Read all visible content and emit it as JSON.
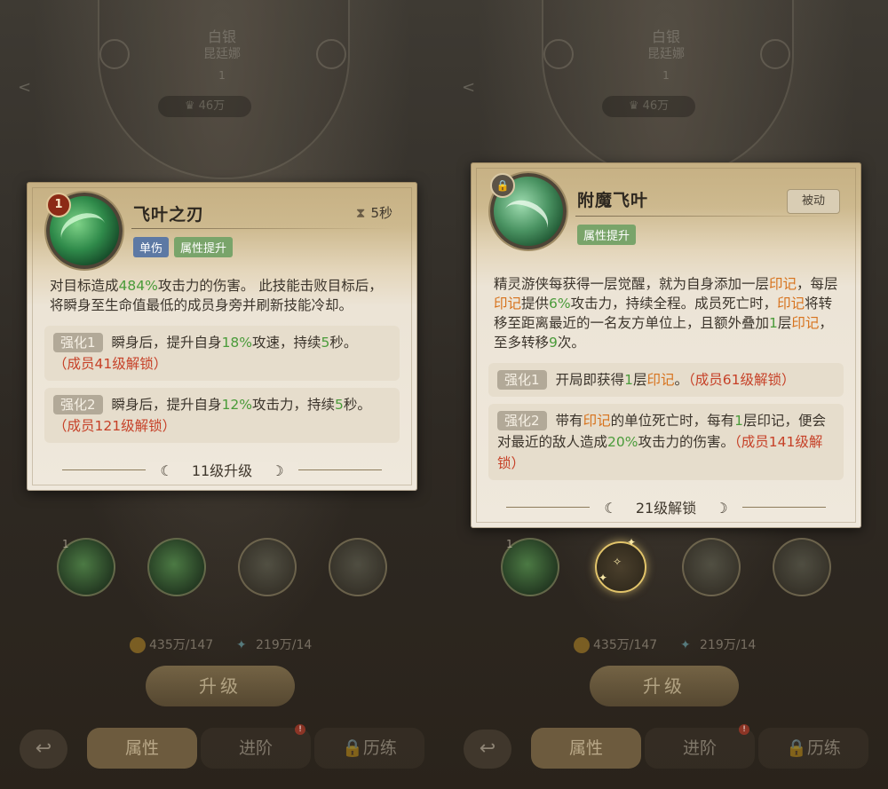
{
  "left": {
    "bg": {
      "title_line1": "白银",
      "title_line2": "昆廷娜",
      "title_line3": "1",
      "power": "46万"
    },
    "card": {
      "badge": "1",
      "name": "飞叶之刃",
      "cooldown": "5秒",
      "tags": [
        "单伤",
        "属性提升"
      ],
      "desc": {
        "p1": "对目标造成",
        "v1": "484%",
        "p2": "攻击力的伤害。 此技能击败目标后，将瞬身至生命值最低的成员身旁并刷新技能冷却。"
      },
      "enh1": {
        "label": "强化1",
        "p1": "瞬身后，提升自身",
        "v1": "18%",
        "p2": "攻速，持续",
        "v2": "5",
        "p3": "秒。",
        "lock": "（成员41级解锁）"
      },
      "enh2": {
        "label": "强化2",
        "p1": "瞬身后，提升自身",
        "v1": "12%",
        "p2": "攻击力，持续",
        "v2": "5",
        "p3": "秒。",
        "lock": "（成员121级解锁）"
      },
      "footer": "11级升级"
    },
    "slots": [
      "1",
      "",
      "",
      ""
    ],
    "cost": {
      "gold": "435万/147",
      "gem": "219万/14"
    },
    "upgrade": "升级",
    "tabs": [
      "属性",
      "进阶",
      "历练"
    ]
  },
  "right": {
    "bg": {
      "title_line1": "白银",
      "title_line2": "昆廷娜",
      "title_line3": "1",
      "power": "46万"
    },
    "card": {
      "name": "附魔飞叶",
      "passive": "被动",
      "tags": [
        "属性提升"
      ],
      "desc": {
        "p1": "精灵游侠每获得一层觉醒，就为自身添加一层",
        "k1": "印记",
        "p2": "，每层",
        "k2": "印记",
        "p3": "提供",
        "v1": "6%",
        "p4": "攻击力，持续全程。成员死亡时，",
        "k3": "印记",
        "p5": "将转移至距离最近的一名友方单位上，且额外叠加",
        "v2": "1",
        "p6": "层",
        "k4": "印记",
        "p7": "，至多转移",
        "v3": "9",
        "p8": "次。"
      },
      "enh1": {
        "label": "强化1",
        "p1": "开局即获得",
        "v1": "1",
        "p2": "层",
        "k1": "印记",
        "p3": "。",
        "lock": "（成员61级解锁）"
      },
      "enh2": {
        "label": "强化2",
        "p1": "带有",
        "k1": "印记",
        "p2": "的单位死亡时，每有",
        "v1": "1",
        "p3": "层印记，便会对最近的敌人造成",
        "v2": "20%",
        "p4": "攻击力的伤害。",
        "lock": "（成员141级解锁）"
      },
      "footer": "21级解锁"
    },
    "slots": [
      "1",
      "",
      "",
      ""
    ],
    "cost": {
      "gold": "435万/147",
      "gem": "219万/14"
    },
    "upgrade": "升级",
    "tabs": [
      "属性",
      "进阶",
      "历练"
    ]
  }
}
